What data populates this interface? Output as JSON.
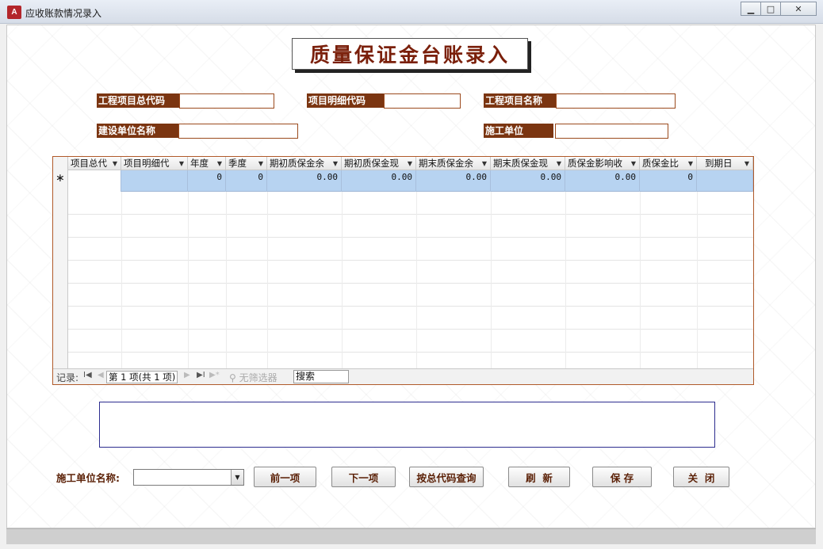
{
  "window": {
    "icon_text": "A",
    "title": "应收账款情况录入",
    "minimize_glyph": "▁",
    "restore_glyph": "□",
    "close_glyph": "✕"
  },
  "heading": "质量保证金台账录入",
  "fields": {
    "project_total_code_label": "工程项目总代码",
    "project_detail_code_label": "项目明细代码",
    "project_name_label": "工程项目名称",
    "construction_unit_label": "建设单位名称",
    "contractor_label": "施工单位"
  },
  "datasheet": {
    "columns": [
      "项目总代",
      "项目明细代",
      "年度",
      "季度",
      "期初质保金余",
      "期初质保金现",
      "期末质保金余",
      "期末质保金现",
      "质保金影响收",
      "质保金比",
      "到期日"
    ],
    "new_row_marker": "∗",
    "new_row_values": [
      "",
      "",
      "0",
      "0",
      "0.00",
      "0.00",
      "0.00",
      "0.00",
      "0.00",
      "0",
      ""
    ],
    "nav": {
      "record_label": "记录:",
      "first_glyph": "I◀",
      "prev_glyph": "◀",
      "position": "第 1 项(共 1 项)",
      "next_glyph": "▶",
      "last_glyph": "▶I",
      "new_glyph": "▶*",
      "filter_label": "无筛选器",
      "search_placeholder": "搜索"
    }
  },
  "bottom": {
    "contractor_name_label": "施工单位名称:",
    "combo_value": "",
    "combo_arrow": "▼",
    "buttons": {
      "prev": "前一项",
      "next": "下一项",
      "query": "按总代码查询",
      "refresh": "刷  新",
      "save": "保 存",
      "close": "关  闭"
    }
  }
}
